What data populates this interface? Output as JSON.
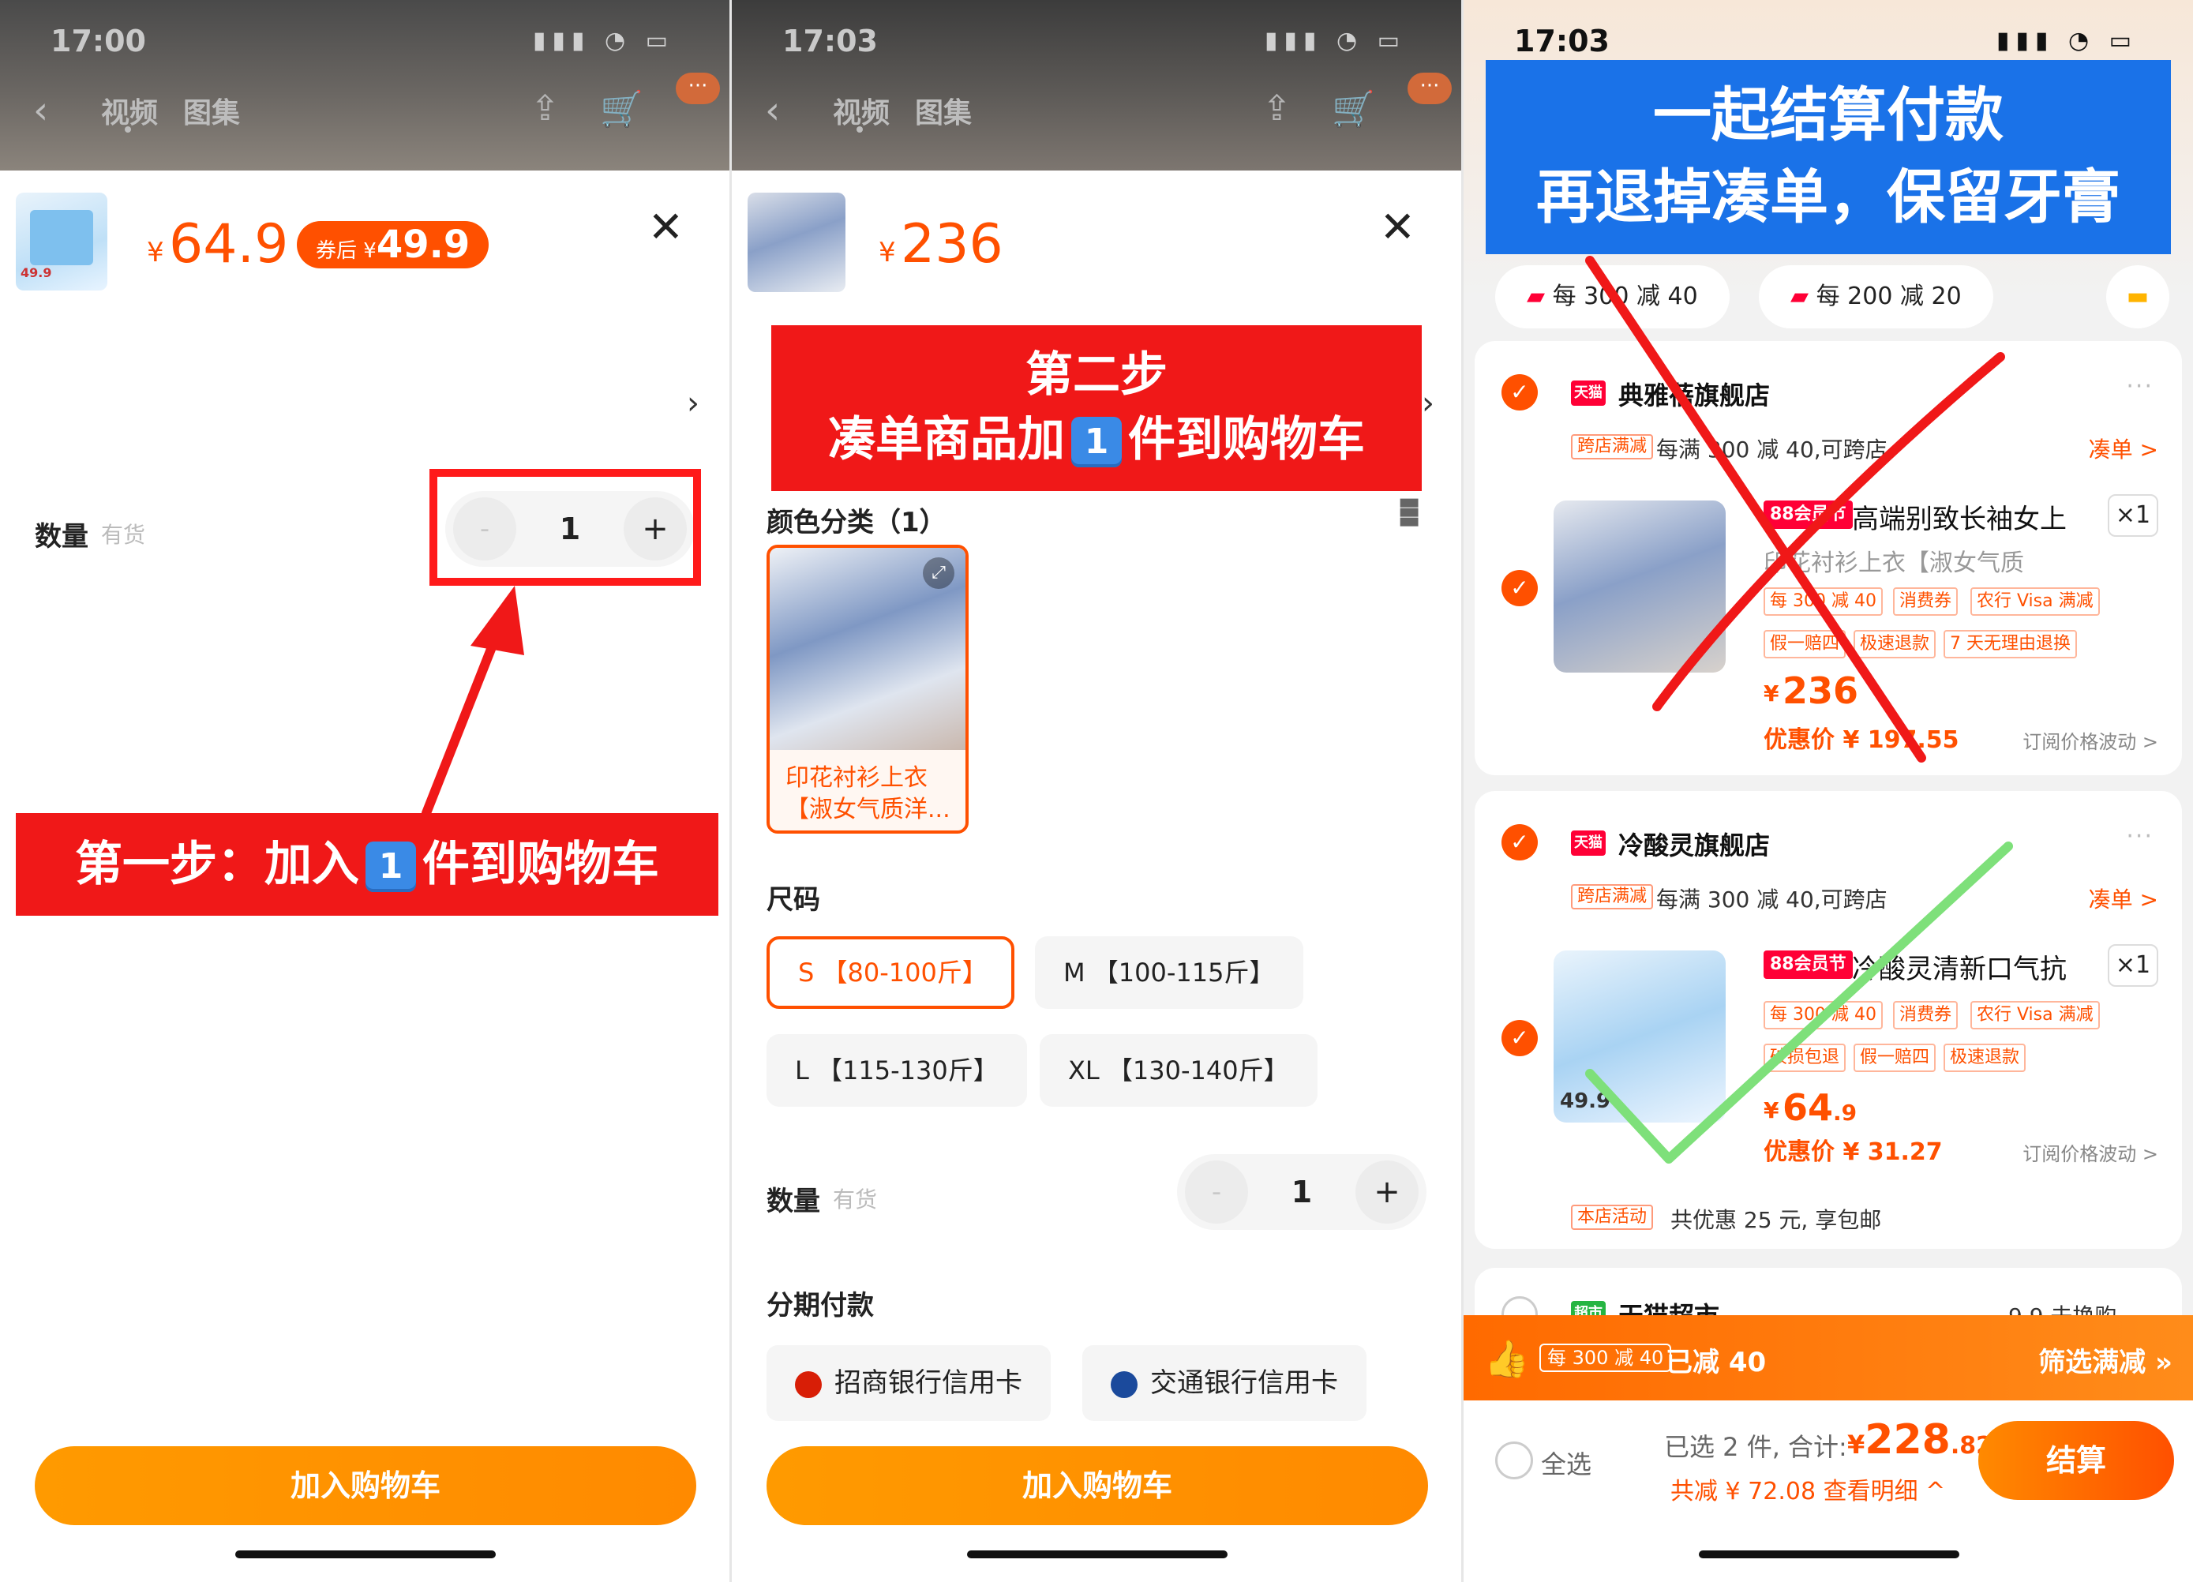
{
  "panel1": {
    "status_time": "17:00",
    "tabs": [
      "视频",
      "图集"
    ],
    "price_yen": "¥",
    "price": "64.9",
    "coupon_prefix": "券后 ¥",
    "coupon_price": "49.9",
    "qty_label": "数量",
    "stock": "有货",
    "qty_minus": "-",
    "qty_value": "1",
    "qty_plus": "+",
    "banner_pre": "第一步：加入",
    "banner_key": "1",
    "banner_post": "件到购物车",
    "cta": "加入购物车",
    "thumb_label": "49.9"
  },
  "panel2": {
    "status_time": "17:03",
    "tabs": [
      "视频",
      "图集"
    ],
    "price_yen": "¥",
    "price": "236",
    "banner_line1": "第二步",
    "banner_line2_pre": "凑单商品加",
    "banner_key": "1",
    "banner_line2_post": "件到购物车",
    "color_label": "颜色分类（1）",
    "swatch_text": "印花衬衫上衣【淑女气质洋...",
    "size_label": "尺码",
    "sizes": [
      "S 【80-100斤】",
      "M 【100-115斤】",
      "L 【115-130斤】",
      "XL 【130-140斤】"
    ],
    "qty_label": "数量",
    "stock": "有货",
    "qty_minus": "-",
    "qty_value": "1",
    "qty_plus": "+",
    "installment_label": "分期付款",
    "banks": [
      "招商银行信用卡",
      "交通银行信用卡"
    ],
    "cta": "加入购物车"
  },
  "panel3": {
    "status_time": "17:03",
    "banner_line1": "一起结算付款",
    "banner_line2": "再退掉凑单，保留牙膏",
    "filters": [
      "每 300 减 40",
      "每 200 减 20"
    ],
    "shop1": {
      "name": "典雅蓓旗舰店",
      "badge": "天猫",
      "promo_tag": "跨店满减",
      "promo_text": "每满 300 减 40,可跨店",
      "coudan": "凑单 >",
      "badge88": "88会员节",
      "title": "高端别致长袖女上",
      "sub": "印花衬衫上衣【淑女气质",
      "qty": "×1",
      "tags_row1": [
        "每 300 减 40",
        "消费券",
        "农行 Visa 满减"
      ],
      "tags_row2": [
        "假一赔四",
        "极速退款",
        "7 天无理由退换"
      ],
      "price_yen": "¥",
      "price": "236",
      "deal": "优惠价 ¥ 197.55",
      "sub_price": "订阅价格波动 >"
    },
    "shop2": {
      "name": "冷酸灵旗舰店",
      "badge": "天猫",
      "promo_tag": "跨店满减",
      "promo_text": "每满 300 减 40,可跨店",
      "coudan": "凑单 >",
      "badge88": "88会员节",
      "title": "冷酸灵清新口气抗",
      "qty": "×1",
      "tags_row1": [
        "每 300 减 40",
        "消费券",
        "农行 Visa 满减"
      ],
      "tags_row2": [
        "破损包退",
        "假一赔四",
        "极速退款"
      ],
      "price_yen": "¥",
      "price": "64",
      "price_dec": ".9",
      "deal": "优惠价 ¥ 31.27",
      "sub_price": "订阅价格波动 >",
      "store_tag": "本店活动",
      "store_text": "共优惠 25 元, 享包邮",
      "thumb_label": "49.9"
    },
    "shop3": {
      "badge": "超市",
      "name": "天猫超市",
      "extra": "9.9 去换购"
    },
    "orange_bar": {
      "tag": "每 300 减 40",
      "text": "已减 40",
      "link": "筛选满减 »"
    },
    "checkout": {
      "select_all": "全选",
      "selected": "已选 2 件, 合计:",
      "total_yen": "¥",
      "total": "228",
      "total_dec": ".82",
      "saved": "共减 ¥ 72.08  查看明细 ^",
      "button": "结算"
    }
  }
}
